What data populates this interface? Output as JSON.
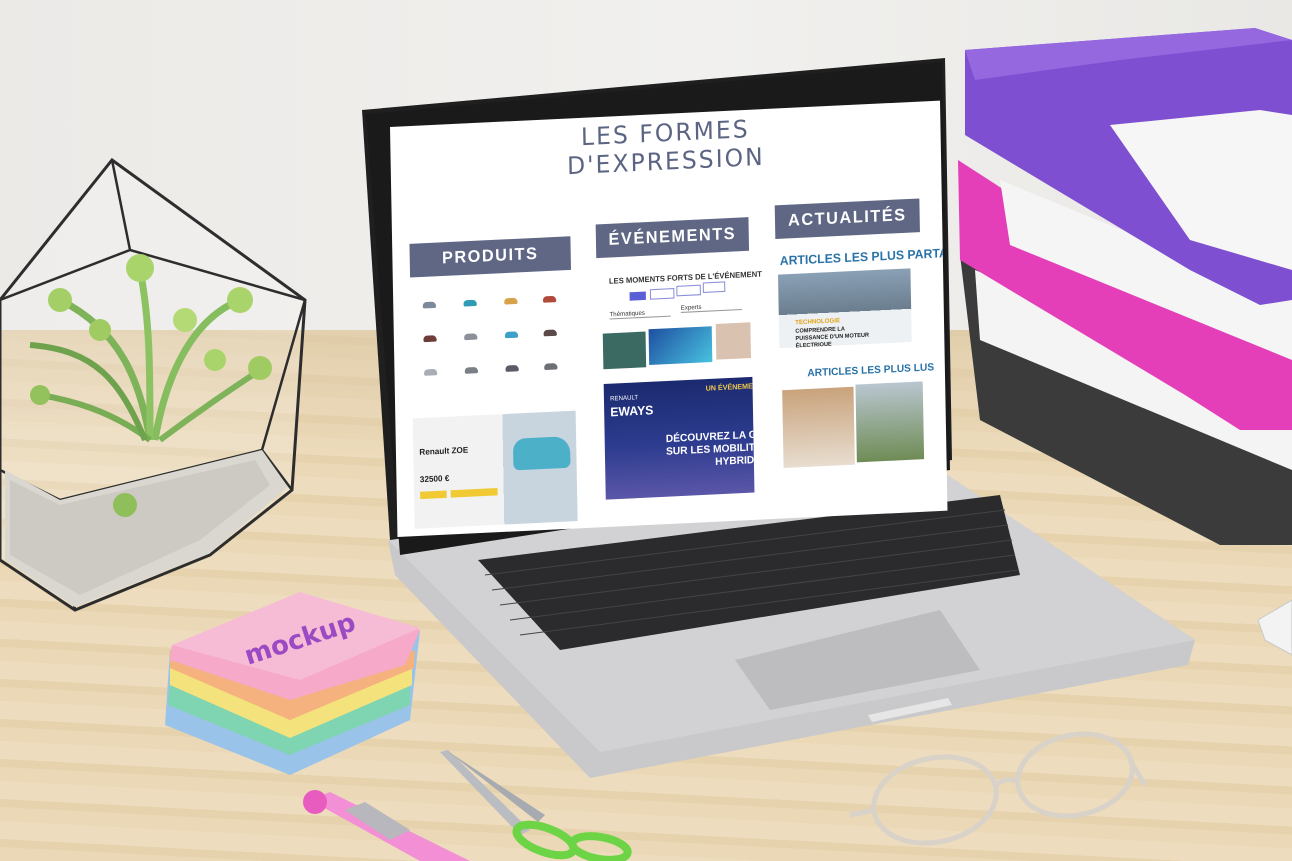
{
  "screen": {
    "title_line1": "LES FORMES",
    "title_line2": "D'EXPRESSION",
    "columns": [
      {
        "label": "PRODUITS"
      },
      {
        "label": "ÉVÉNEMENTS"
      },
      {
        "label": "ACTUALITÉS"
      }
    ],
    "events_subtitle": "LES MOMENTS FORTS DE L'ÉVÉNEMENT",
    "events_filters": [
      "Thématiques",
      "Experts"
    ],
    "news_sub1": "ARTICLES LES PLUS PARTAGÉS",
    "news_sub2": "ARTICLES LES PLUS LUS",
    "news_card_tag": "TECHNOLOGIE",
    "news_card_text": "COMPRENDRE LA PUISSANCE D'UN MOTEUR ÉLECTRIQUE",
    "promo_title": "Renault ZOE",
    "promo_price": "32500 €",
    "banner_tag": "UN ÉVÉNEMENT",
    "banner_logo": "EWAYS",
    "banner_brand": "RENAULT",
    "banner_line1": "DÉCOUVREZ LA GRAN",
    "banner_line2": "SUR LES MOBILITÉS",
    "banner_line3": "HYBRID"
  },
  "props": {
    "sticky_note_text": "mockup"
  },
  "colors": {
    "header_band": "#5f6784",
    "title_text": "#5c6483",
    "accent_blue": "#2a73a8",
    "tray_purple": "#7e4fd0",
    "tray_pink": "#e43fb8"
  }
}
